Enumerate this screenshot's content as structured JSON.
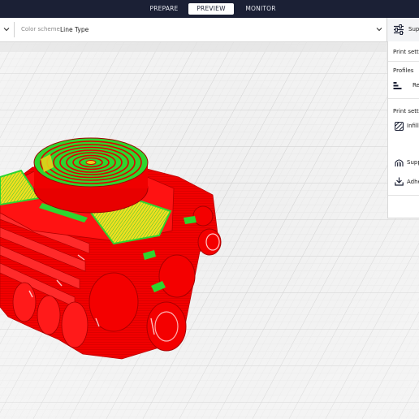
{
  "stages": {
    "prepare": "PREPARE",
    "preview": "PREVIEW",
    "monitor": "MONITOR"
  },
  "toolbar": {
    "color_scheme_label": "Color scheme",
    "color_scheme_value": "Line Type",
    "settings_label": "Supp"
  },
  "panel": {
    "title": "Print settin",
    "profiles_label": "Profiles",
    "profile_value": "Res",
    "print_settings_label": "Print settin",
    "infill_label": "Infill (",
    "support_label": "Supp",
    "adhesion_label": "Adhe"
  },
  "colors": {
    "topbar": "#1b2035",
    "wall": "#ff0000",
    "infill": "#e6d21a",
    "skin": "#2ed52e",
    "build_plate": "#efefef"
  },
  "icons": {
    "left_chevron": "chevron-down-icon",
    "color_scheme_chevron": "chevron-down-icon",
    "settings": "sliders-icon",
    "profile": "profile-bars-icon",
    "infill": "infill-icon",
    "support": "support-icon",
    "adhesion": "adhesion-icon"
  }
}
